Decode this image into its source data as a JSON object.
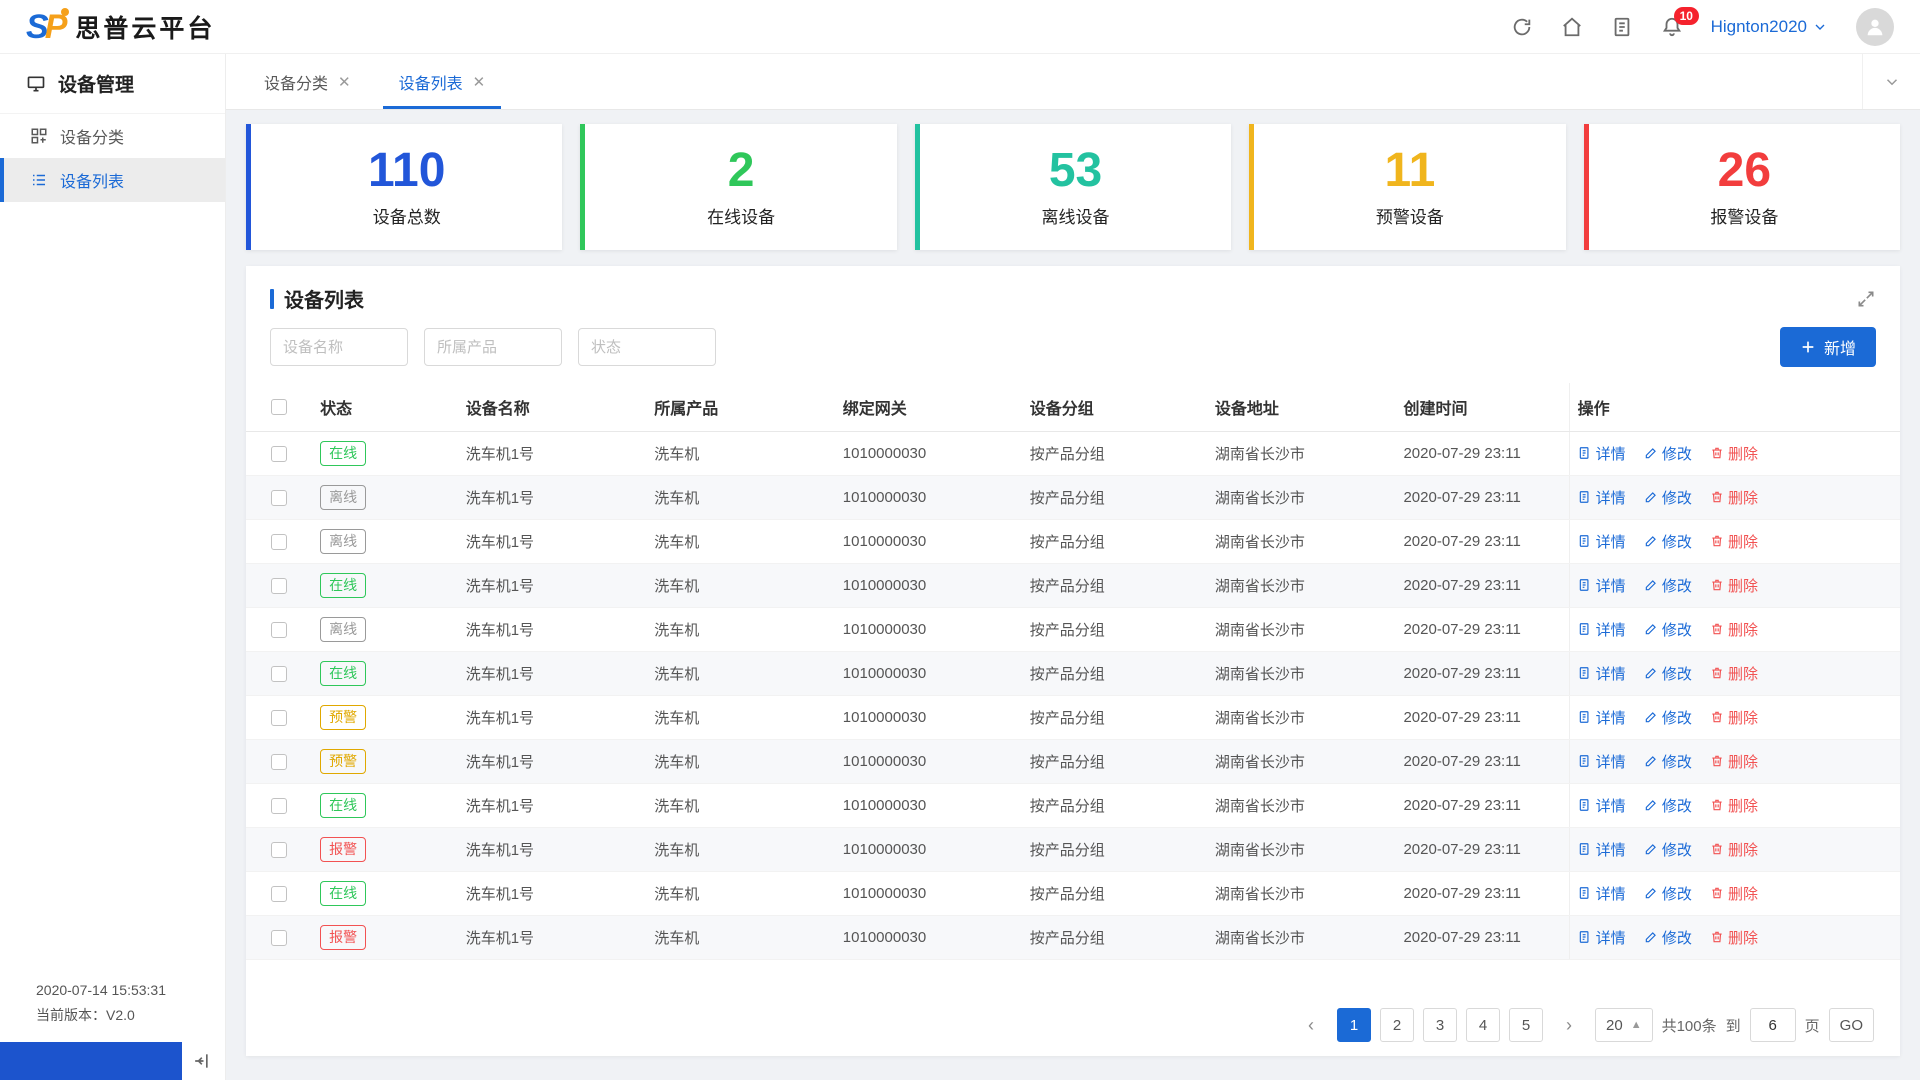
{
  "header": {
    "brand": "思普云平台",
    "logo": "SP",
    "notification_count": "10",
    "username": "Hignton2020"
  },
  "sidebar": {
    "title": "设备管理",
    "items": [
      {
        "label": "设备分类"
      },
      {
        "label": "设备列表"
      }
    ],
    "footer_time": "2020-07-14 15:53:31",
    "footer_version": "当前版本：V2.0"
  },
  "tabs": [
    {
      "label": "设备分类"
    },
    {
      "label": "设备列表"
    }
  ],
  "stats": [
    {
      "value": "110",
      "label": "设备总数",
      "color": "#2256d9"
    },
    {
      "value": "2",
      "label": "在线设备",
      "color": "#2fc75a"
    },
    {
      "value": "53",
      "label": "离线设备",
      "color": "#23c2a0"
    },
    {
      "value": "11",
      "label": "预警设备",
      "color": "#f0b51d"
    },
    {
      "value": "26",
      "label": "报警设备",
      "color": "#f23d3d"
    }
  ],
  "panel": {
    "title": "设备列表",
    "filters": [
      {
        "placeholder": "设备名称"
      },
      {
        "placeholder": "所属产品"
      },
      {
        "placeholder": "状态"
      }
    ],
    "add_button": "新增"
  },
  "table": {
    "columns": [
      "状态",
      "设备名称",
      "所属产品",
      "绑定网关",
      "设备分组",
      "设备地址",
      "创建时间",
      "操作"
    ],
    "status_colors": {
      "在线": "#2fc75a",
      "离线": "#9a9a9a",
      "预警": "#e0a800",
      "报警": "#f25252"
    },
    "actions": {
      "detail": "详情",
      "edit": "修改",
      "delete": "删除"
    },
    "rows": [
      {
        "status": "在线",
        "name": "洗车机1号",
        "product": "洗车机",
        "gateway": "1010000030",
        "group": "按产品分组",
        "address": "湖南省长沙市",
        "created": "2020-07-29 23:11"
      },
      {
        "status": "离线",
        "name": "洗车机1号",
        "product": "洗车机",
        "gateway": "1010000030",
        "group": "按产品分组",
        "address": "湖南省长沙市",
        "created": "2020-07-29 23:11"
      },
      {
        "status": "离线",
        "name": "洗车机1号",
        "product": "洗车机",
        "gateway": "1010000030",
        "group": "按产品分组",
        "address": "湖南省长沙市",
        "created": "2020-07-29 23:11"
      },
      {
        "status": "在线",
        "name": "洗车机1号",
        "product": "洗车机",
        "gateway": "1010000030",
        "group": "按产品分组",
        "address": "湖南省长沙市",
        "created": "2020-07-29 23:11"
      },
      {
        "status": "离线",
        "name": "洗车机1号",
        "product": "洗车机",
        "gateway": "1010000030",
        "group": "按产品分组",
        "address": "湖南省长沙市",
        "created": "2020-07-29 23:11"
      },
      {
        "status": "在线",
        "name": "洗车机1号",
        "product": "洗车机",
        "gateway": "1010000030",
        "group": "按产品分组",
        "address": "湖南省长沙市",
        "created": "2020-07-29 23:11"
      },
      {
        "status": "预警",
        "name": "洗车机1号",
        "product": "洗车机",
        "gateway": "1010000030",
        "group": "按产品分组",
        "address": "湖南省长沙市",
        "created": "2020-07-29 23:11"
      },
      {
        "status": "预警",
        "name": "洗车机1号",
        "product": "洗车机",
        "gateway": "1010000030",
        "group": "按产品分组",
        "address": "湖南省长沙市",
        "created": "2020-07-29 23:11"
      },
      {
        "status": "在线",
        "name": "洗车机1号",
        "product": "洗车机",
        "gateway": "1010000030",
        "group": "按产品分组",
        "address": "湖南省长沙市",
        "created": "2020-07-29 23:11"
      },
      {
        "status": "报警",
        "name": "洗车机1号",
        "product": "洗车机",
        "gateway": "1010000030",
        "group": "按产品分组",
        "address": "湖南省长沙市",
        "created": "2020-07-29 23:11"
      },
      {
        "status": "在线",
        "name": "洗车机1号",
        "product": "洗车机",
        "gateway": "1010000030",
        "group": "按产品分组",
        "address": "湖南省长沙市",
        "created": "2020-07-29 23:11"
      },
      {
        "status": "报警",
        "name": "洗车机1号",
        "product": "洗车机",
        "gateway": "1010000030",
        "group": "按产品分组",
        "address": "湖南省长沙市",
        "created": "2020-07-29 23:11"
      }
    ]
  },
  "pagination": {
    "pages": [
      "1",
      "2",
      "3",
      "4",
      "5"
    ],
    "active_page": "1",
    "page_size": "20",
    "total_text": "共100条",
    "jump_prefix": "到",
    "jump_value": "6",
    "jump_suffix": "页",
    "go_label": "GO"
  }
}
